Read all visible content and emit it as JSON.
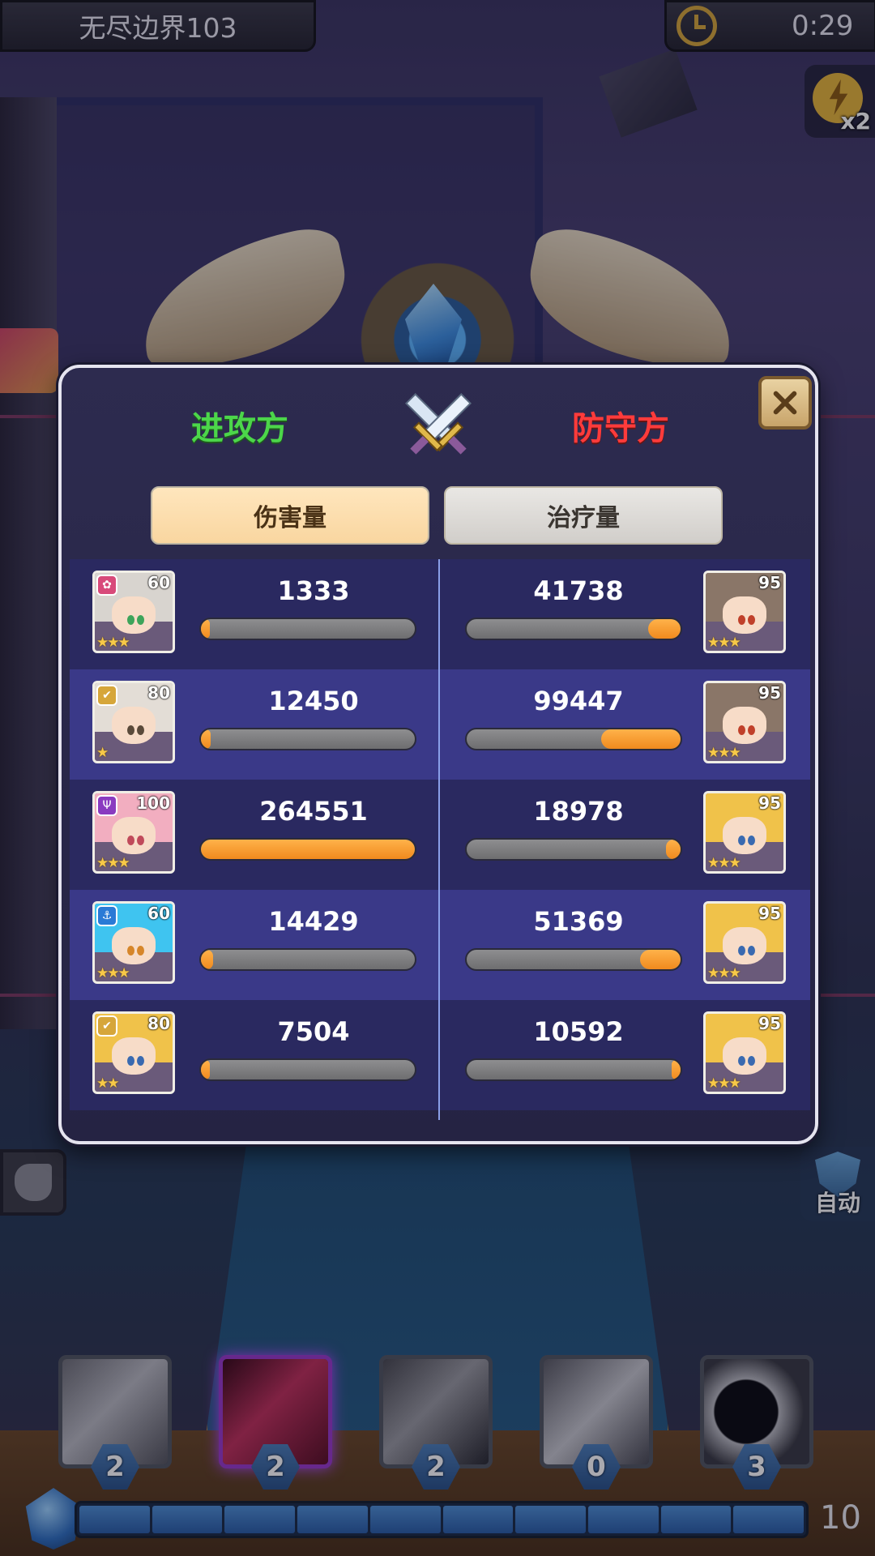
{
  "hud": {
    "stage_title": "无尽边界103",
    "timer": "0:29",
    "speed_label": "x2",
    "auto_label": "自动"
  },
  "modal": {
    "attacker_label": "进攻方",
    "defender_label": "防守方",
    "tabs": [
      {
        "label": "伤害量",
        "selected": true
      },
      {
        "label": "治疗量",
        "selected": false
      }
    ],
    "rows": [
      {
        "attacker": {
          "level": "60",
          "stars": "★★★",
          "faction": "✿",
          "faction_color": "#d84a7a",
          "hair": "#d8d4cf",
          "eye": "#3da45a",
          "value": "1333",
          "ratio": 0.005
        },
        "defender": {
          "level": "95",
          "stars": "★★★",
          "hair": "#8a7668",
          "eye": "#c0402a",
          "value": "41738",
          "ratio": 0.15
        }
      },
      {
        "attacker": {
          "level": "80",
          "stars": "★",
          "faction": "✔",
          "faction_color": "#d6a63a",
          "hair": "#e3ddd6",
          "eye": "#5a4a3a",
          "value": "12450",
          "ratio": 0.047
        },
        "defender": {
          "level": "95",
          "stars": "★★★",
          "hair": "#8a7668",
          "eye": "#c0402a",
          "value": "99447",
          "ratio": 0.37
        }
      },
      {
        "attacker": {
          "level": "100",
          "stars": "★★★",
          "faction": "Ψ",
          "faction_color": "#8a3ac0",
          "hair": "#f2aec0",
          "eye": "#c04a5a",
          "value": "264551",
          "ratio": 1.0
        },
        "defender": {
          "level": "95",
          "stars": "★★★",
          "hair": "#f0c24a",
          "eye": "#3a6ab0",
          "value": "18978",
          "ratio": 0.07
        }
      },
      {
        "attacker": {
          "level": "60",
          "stars": "★★★",
          "faction": "⚓",
          "faction_color": "#2a7ad6",
          "hair": "#3fc4f0",
          "eye": "#d6862a",
          "value": "14429",
          "ratio": 0.055
        },
        "defender": {
          "level": "95",
          "stars": "★★★",
          "hair": "#f0c24a",
          "eye": "#3a6ab0",
          "value": "51369",
          "ratio": 0.19
        }
      },
      {
        "attacker": {
          "level": "80",
          "stars": "★★",
          "faction": "✔",
          "faction_color": "#d6a63a",
          "hair": "#f0c24a",
          "eye": "#3a6ab0",
          "value": "7504",
          "ratio": 0.028
        },
        "defender": {
          "level": "95",
          "stars": "★★★",
          "hair": "#f0c24a",
          "eye": "#3a6ab0",
          "value": "10592",
          "ratio": 0.04
        }
      }
    ]
  },
  "skills": [
    {
      "name": "sword-skill",
      "count": "2",
      "active": false,
      "art": "linear-gradient(135deg,#6f6f76,#b9b9c0 45%,#55555c)"
    },
    {
      "name": "slash-skill",
      "count": "2",
      "active": true,
      "art": "linear-gradient(135deg,#3a0a18,#c0305a 45%,#5a1024)"
    },
    {
      "name": "potion-skill",
      "count": "2",
      "active": false,
      "art": "linear-gradient(135deg,#4a4a50,#9a9aa0 45%,#2a2a30)"
    },
    {
      "name": "phoenix-skill",
      "count": "0",
      "active": false,
      "art": "linear-gradient(135deg,#5a5a62,#c6c6cc 50%,#4a4a52)"
    },
    {
      "name": "moon-skill",
      "count": "3",
      "active": false,
      "art": "radial-gradient(circle at 40% 50%,#0c0c10 0 38%,#b8b8be 40%,#3a3a42 70%)"
    }
  ],
  "energy": {
    "count": "10",
    "segments": 10
  }
}
